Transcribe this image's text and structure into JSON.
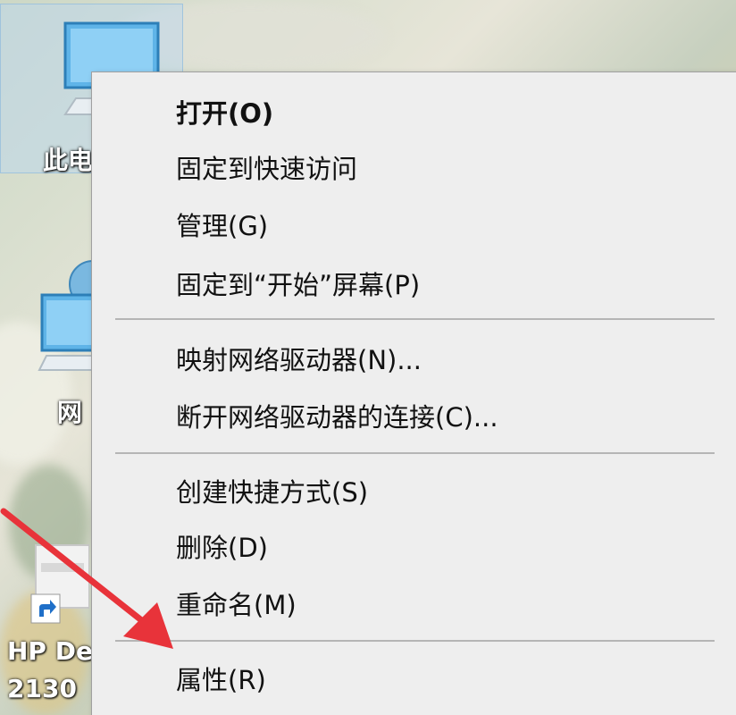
{
  "desktop": {
    "icons": [
      {
        "name": "this-pc",
        "label": "此电"
      },
      {
        "name": "network",
        "label": "网"
      },
      {
        "name": "hp-printer",
        "label_line1": "HP De",
        "label_line2": "2130"
      }
    ]
  },
  "context_menu": {
    "groups": [
      [
        {
          "label": "打开(O)",
          "bold": true
        },
        {
          "label": "固定到快速访问"
        },
        {
          "label": "管理(G)"
        },
        {
          "label": "固定到“开始”屏幕(P)"
        }
      ],
      [
        {
          "label": "映射网络驱动器(N)..."
        },
        {
          "label": "断开网络驱动器的连接(C)..."
        }
      ],
      [
        {
          "label": "创建快捷方式(S)"
        },
        {
          "label": "删除(D)"
        },
        {
          "label": "重命名(M)"
        }
      ],
      [
        {
          "label": "属性(R)"
        }
      ]
    ]
  },
  "annotation": {
    "arrow_color": "#e8333a",
    "arrow_icon": "red-pointer-arrow-icon"
  }
}
